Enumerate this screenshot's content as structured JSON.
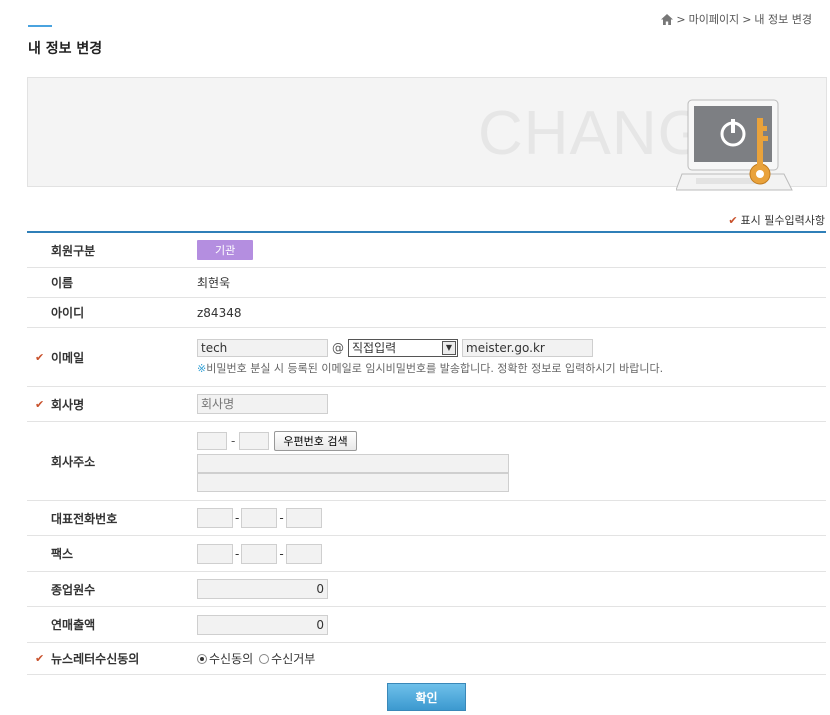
{
  "page": {
    "title": "내 정보 변경"
  },
  "breadcrumb": {
    "items": [
      "마이페이지",
      "내 정보 변경"
    ],
    "sep": ">"
  },
  "banner": {
    "word": "CHANGE"
  },
  "required_note": "표시 필수입력사항",
  "check_mark": "✔",
  "form": {
    "member_type": {
      "label": "회원구분",
      "value": "기관"
    },
    "name": {
      "label": "이름",
      "value": "최현욱"
    },
    "user_id": {
      "label": "아이디",
      "value": "z84348"
    },
    "email": {
      "label": "이메일",
      "local": "tech",
      "at": "@",
      "select_value": "직접입력",
      "domain": "meister.go.kr",
      "note_mark": "※",
      "note": "비밀번호 분실 시 등록된 이메일로 임시비밀번호를 발송합니다. 정확한 정보로 입력하시기 바랍니다."
    },
    "company_name": {
      "label": "회사명",
      "placeholder": "회사명"
    },
    "company_address": {
      "label": "회사주소",
      "dash": "-",
      "zip_button": "우편번호 검색"
    },
    "phone": {
      "label": "대표전화번호",
      "dash": "-"
    },
    "fax": {
      "label": "팩스",
      "dash": "-"
    },
    "employees": {
      "label": "종업원수",
      "value": "0"
    },
    "annual_sales": {
      "label": "연매출액",
      "value": "0"
    },
    "newsletter": {
      "label": "뉴스레터수신동의",
      "option_agree": "수신동의",
      "option_decline": "수신거부",
      "selected": "수신동의"
    }
  },
  "confirm_button": "확인",
  "colors": {
    "accent": "#2f7fb8",
    "badge": "#b48ee0",
    "check": "#c8502a",
    "button": "#3c99cf"
  }
}
